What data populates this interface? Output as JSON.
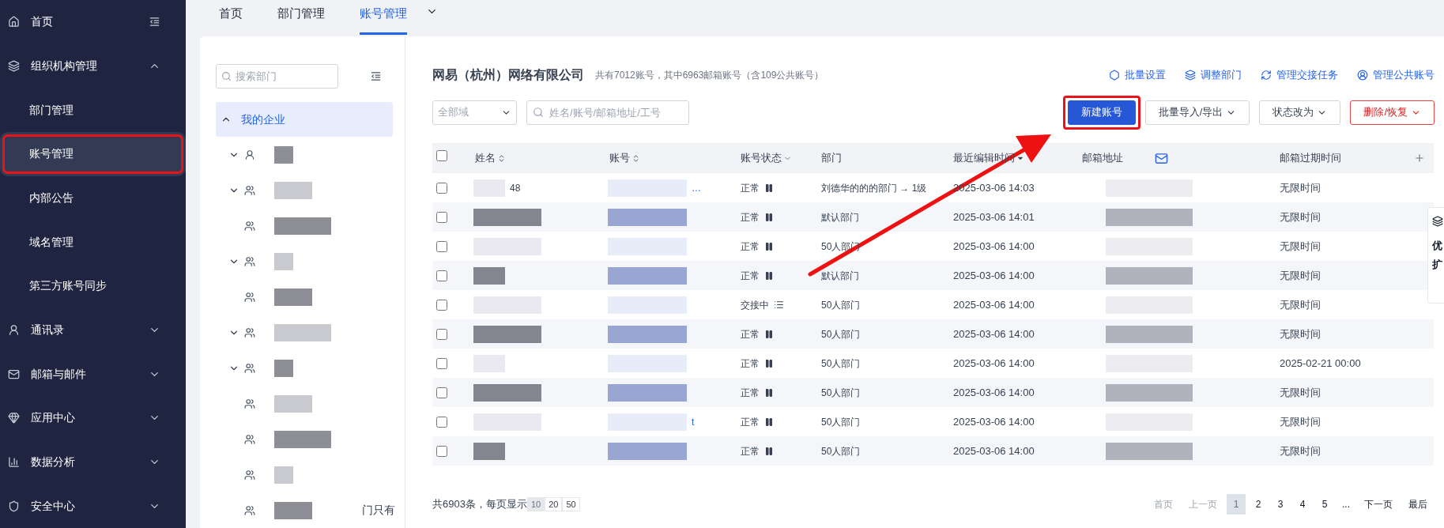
{
  "sidebar": {
    "items": [
      {
        "label": "首页",
        "selected": false
      },
      {
        "label": "组织机构管理",
        "selected": false,
        "expanded": true,
        "children": [
          {
            "label": "部门管理",
            "selected": false,
            "annotated": false
          },
          {
            "label": "账号管理",
            "selected": true,
            "annotated": true
          },
          {
            "label": "内部公告",
            "selected": false,
            "annotated": false
          },
          {
            "label": "域名管理",
            "selected": false,
            "annotated": false
          },
          {
            "label": "第三方账号同步",
            "selected": false,
            "annotated": false
          }
        ]
      },
      {
        "label": "通讯录",
        "selected": false,
        "expanded": false
      },
      {
        "label": "邮箱与邮件",
        "selected": false,
        "expanded": false
      },
      {
        "label": "应用中心",
        "selected": false,
        "expanded": false
      },
      {
        "label": "数据分析",
        "selected": false,
        "expanded": false
      },
      {
        "label": "安全中心",
        "selected": false,
        "expanded": false
      }
    ]
  },
  "tabs": [
    {
      "label": "首页",
      "selected": false
    },
    {
      "label": "部门管理",
      "selected": false
    },
    {
      "label": "账号管理",
      "selected": true
    }
  ],
  "tree": {
    "search_placeholder": "搜索部门",
    "root": {
      "label": "我的企业",
      "expanded": true,
      "selected": true
    },
    "items": [
      {
        "kind": "person",
        "expanded": false
      },
      {
        "kind": "group",
        "expanded": false
      },
      {
        "kind": "group"
      },
      {
        "kind": "group",
        "expanded": false
      },
      {
        "kind": "group"
      },
      {
        "kind": "group",
        "expanded": false
      },
      {
        "kind": "group",
        "expanded": false
      },
      {
        "kind": "group"
      },
      {
        "kind": "group"
      },
      {
        "kind": "group"
      },
      {
        "kind": "group",
        "label": "门只有"
      }
    ]
  },
  "company": {
    "name": "网易（杭州）网络有限公司",
    "summary": "共有7012账号，其中6963邮箱账号（含109公共账号）"
  },
  "links": [
    "批量设置",
    "调整部门",
    "管理交接任务",
    "管理公共账号"
  ],
  "filters": {
    "domain": "全部域",
    "search_placeholder": "姓名/账号/邮箱地址/工号"
  },
  "buttons": [
    {
      "label": "新建账号",
      "kind": "primary",
      "annotated": true
    },
    {
      "label": "批量导入/导出",
      "kind": "default",
      "annotated": false
    },
    {
      "label": "状态改为",
      "kind": "default",
      "annotated": false
    },
    {
      "label": "删除/恢复",
      "kind": "danger",
      "annotated": false
    }
  ],
  "table": {
    "all_checked": false,
    "columns": [
      {
        "label": "姓名",
        "kind": "sort"
      },
      {
        "label": "账号",
        "kind": "sort"
      },
      {
        "label": "账号状态",
        "kind": "filter"
      },
      {
        "label": "部门",
        "kind": "plain"
      },
      {
        "label": "最近编辑时间",
        "kind": "sorted"
      },
      {
        "label": "邮箱地址",
        "kind": "mail"
      },
      {
        "label": "邮箱过期时间",
        "kind": "plain"
      }
    ],
    "rows": [
      {
        "checked": false,
        "name": "48",
        "account": "…",
        "status": "正常",
        "kind": "normal",
        "department": "刘德华的的的部门 → 1级",
        "edited": "2025-03-06 14:03",
        "expiry": "无限时间"
      },
      {
        "checked": false,
        "status": "正常",
        "kind": "normal",
        "department": "默认部门",
        "edited": "2025-03-06 14:01",
        "expiry": "无限时间"
      },
      {
        "checked": false,
        "status": "正常",
        "kind": "normal",
        "department": "50人部门",
        "edited": "2025-03-06 14:00",
        "expiry": "无限时间"
      },
      {
        "checked": false,
        "status": "正常",
        "kind": "normal",
        "department": "默认部门",
        "edited": "2025-03-06 14:00",
        "expiry": "无限时间"
      },
      {
        "checked": false,
        "status": "交接中",
        "kind": "handover",
        "department": "50人部门",
        "edited": "2025-03-06 14:00",
        "expiry": "无限时间"
      },
      {
        "checked": false,
        "status": "正常",
        "kind": "normal",
        "department": "50人部门",
        "edited": "2025-03-06 14:00",
        "expiry": "无限时间"
      },
      {
        "checked": false,
        "status": "正常",
        "kind": "normal",
        "department": "50人部门",
        "edited": "2025-03-06 14:00",
        "expiry": "2025-02-21 00:00"
      },
      {
        "checked": false,
        "status": "正常",
        "kind": "normal",
        "department": "50人部门",
        "edited": "2025-03-06 14:00",
        "expiry": "无限时间"
      },
      {
        "checked": false,
        "account": "t",
        "status": "正常",
        "kind": "normal",
        "department": "50人部门",
        "edited": "2025-03-06 14:00",
        "expiry": "无限时间"
      },
      {
        "checked": false,
        "status": "正常",
        "kind": "normal",
        "department": "50人部门",
        "edited": "2025-03-06 14:00",
        "expiry": "无限时间"
      }
    ]
  },
  "pagination": {
    "summary": "共6903条，每页显示",
    "page_sizes": [
      {
        "label": "10",
        "selected": true
      },
      {
        "label": "20",
        "selected": false
      },
      {
        "label": "50",
        "selected": false
      }
    ],
    "pages": [
      {
        "label": "首页",
        "kind": "nav",
        "disabled": true
      },
      {
        "label": "上一页",
        "kind": "nav",
        "disabled": true
      },
      {
        "label": "1",
        "kind": "page",
        "selected": true
      },
      {
        "label": "2",
        "kind": "page",
        "selected": false
      },
      {
        "label": "3",
        "kind": "page",
        "selected": false
      },
      {
        "label": "4",
        "kind": "page",
        "selected": false
      },
      {
        "label": "5",
        "kind": "page",
        "selected": false
      },
      {
        "label": "...",
        "kind": "ellipsis"
      },
      {
        "label": "下一页",
        "kind": "nav",
        "disabled": false
      },
      {
        "label": "最后",
        "kind": "nav",
        "disabled": false
      }
    ]
  },
  "side_widget": {
    "texts": [
      "优",
      "扩"
    ]
  }
}
